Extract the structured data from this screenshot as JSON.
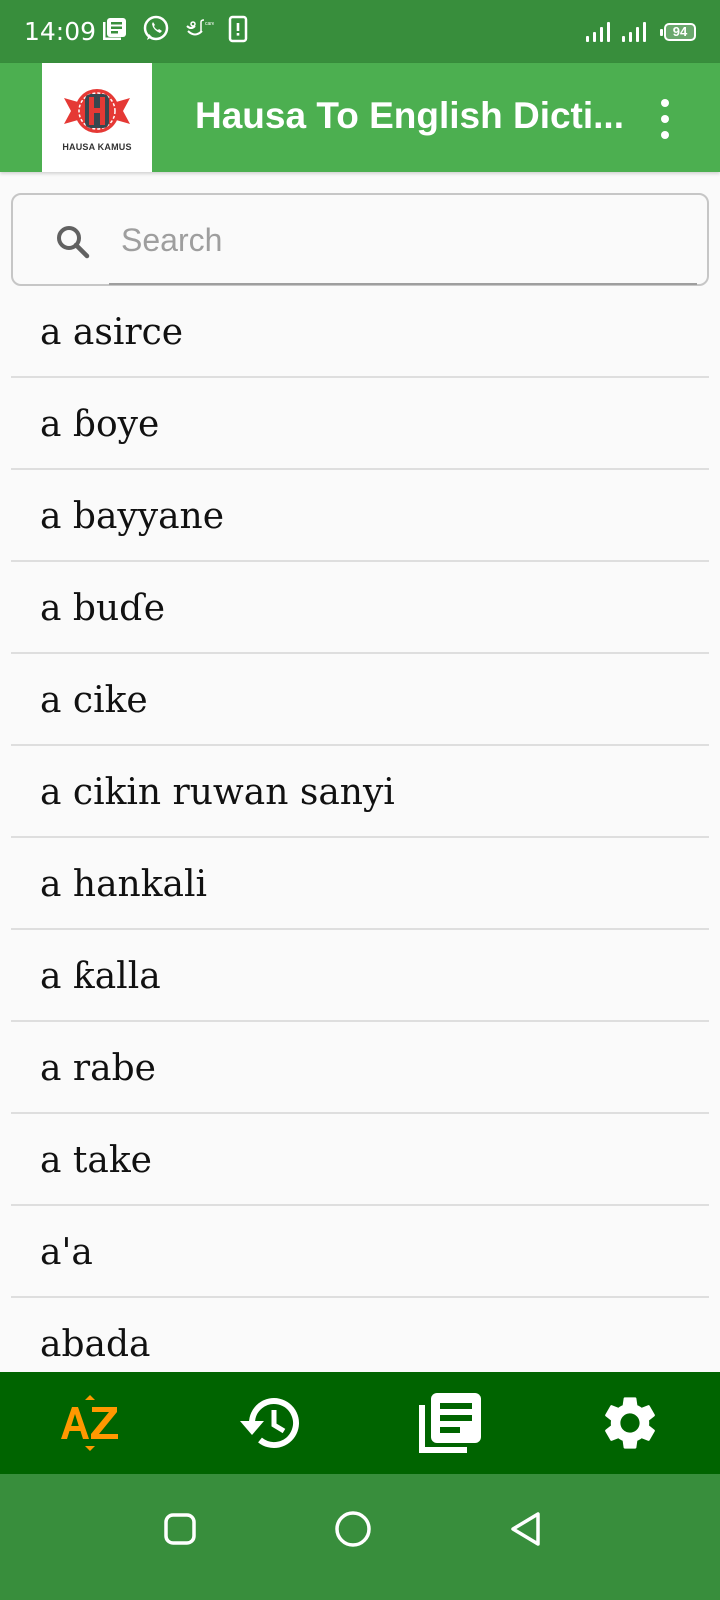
{
  "status_bar": {
    "time": "14:09",
    "notification_icons": [
      "news-icon",
      "whatsapp-icon",
      "carrier-care-icon",
      "device-alert-icon"
    ],
    "battery_level": "94",
    "signal_icons": [
      "signal-sim1-icon",
      "signal-sim2-icon"
    ]
  },
  "app_bar": {
    "logo_text": "HAUSA KAMUS",
    "title": "Hausa To English Dicti...",
    "menu_icon": "overflow-menu-icon",
    "background_color": "#4caf50"
  },
  "search": {
    "placeholder": "Search",
    "value": ""
  },
  "word_list": [
    "a asirce",
    "a ɓoye",
    "a bayyane",
    "a buɗe",
    "a cike",
    "a cikin ruwan sanyi",
    "a hankali",
    "a ƙalla",
    "a rabe",
    "a take",
    "a'a",
    "abada"
  ],
  "bottom_nav": {
    "items": [
      {
        "name": "az-index",
        "icon": "sort-az-icon",
        "active": true
      },
      {
        "name": "history",
        "icon": "history-icon",
        "active": false
      },
      {
        "name": "saved",
        "icon": "article-list-icon",
        "active": false
      },
      {
        "name": "settings",
        "icon": "gear-icon",
        "active": false
      }
    ],
    "active_color": "#ff9800",
    "background_color": "#006400"
  },
  "system_nav": {
    "buttons": [
      "recents",
      "home",
      "back"
    ]
  }
}
